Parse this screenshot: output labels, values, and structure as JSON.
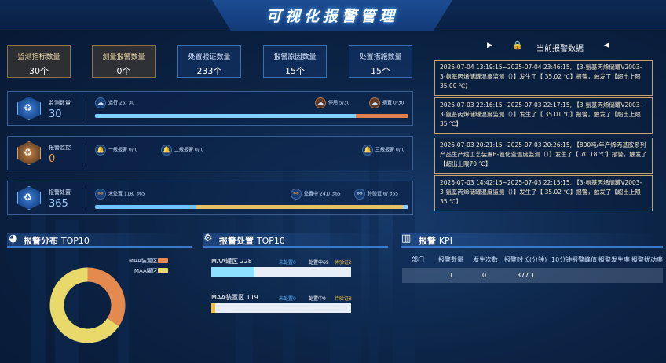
{
  "header": {
    "title": "可视化报警管理"
  },
  "kpis": [
    {
      "label": "监测指标数量",
      "value": "30个"
    },
    {
      "label": "测量报警数量",
      "value": "0个"
    },
    {
      "label": "处置验证数量",
      "value": "233个"
    },
    {
      "label": "报警原因数量",
      "value": "15个"
    },
    {
      "label": "处置措施数量",
      "value": "15个"
    }
  ],
  "monitor": {
    "name": "监测数量",
    "value": "30",
    "running": "运行 25/ 30",
    "stopped": "停用 5/30",
    "removed": "摘置 0/30",
    "running_fraction": 0.833
  },
  "alarm_level": {
    "name": "报警监控",
    "value": "0",
    "level1": "一级报警 0/ 0",
    "level2": "二级报警 0/ 0",
    "level3": "三级报警 0/ 0"
  },
  "disposal": {
    "name": "报警处置",
    "value": "365",
    "unhandled": "未处置 118/ 365",
    "handling": "处置中 241/ 365",
    "verifying": "待验证 6/ 365",
    "unhandled_fraction": 0.323,
    "handling_fraction": 0.66,
    "verifying_fraction": 0.016
  },
  "right_panel": {
    "title": "当前报警数据",
    "alarms": [
      "2025-07-04 13:19:15~2025-07-04 23:46:15, 【3-氨基丙烯储罐V2003-3-氨基丙烯储罐温度监测（）】发生了【 35.02 ℃】报警，触发了【超出上限35.00 ℃】",
      "2025-07-03 22:16:15~2025-07-03 22:17:15, 【3-氨基丙烯储罐V2003-3-氨基丙烯储罐温度监测（）】发生了【 35.01 ℃】报警，触发了【超出上限35 ℃】",
      "2025-07-03 20:21:15~2025-07-03 20:26:15, 【800吨/年产烯丙基胺系列产品生产线工艺装置B-氨化釜温度监测（）】发生了【 70.18 ℃】报警，触发了【超出上限70 ℃】",
      "2025-07-03 14:42:15~2025-07-03 22:15:15, 【3-氨基丙烯储罐V2003-3-氨基丙烯储罐温度监测（）】发生了【 35.02 ℃】报警，触发了【超出上限35 ℃】"
    ]
  },
  "distribution": {
    "title_cn": "报警分布",
    "title_en": "TOP10",
    "legend": [
      "MAA装置区",
      "MAA罐区"
    ],
    "colors": [
      "#e48a4e",
      "#e8d96a"
    ],
    "chart_data": {
      "type": "pie",
      "categories": [
        "MAA装置区",
        "MAA罐区"
      ],
      "values": [
        119,
        228
      ]
    }
  },
  "disposal_top": {
    "title_cn": "报警处置",
    "title_en": "TOP10",
    "zones": [
      {
        "label": "MAA罐区 228",
        "unhandled": "未处置0",
        "handling": "处置中69",
        "verify": "待验证2",
        "fill_fraction": 0.31,
        "fill_color": "#8de0ff"
      },
      {
        "label": "MAA装置区 119",
        "unhandled": "未处置0",
        "handling": "处置中0",
        "verify": "待验证8",
        "fill_fraction": 0.03,
        "fill_color": "#f0c040"
      }
    ]
  },
  "alarm_kpi": {
    "title_cn": "报警",
    "title_en": "KPI",
    "columns": [
      "部门",
      "报警数量",
      "发生次数",
      "报警时长(分钟)",
      "10分钟报警峰值",
      "报警发生率",
      "报警扰动率"
    ],
    "row": [
      "",
      "1",
      "0",
      "377.1",
      "",
      "",
      ""
    ]
  }
}
